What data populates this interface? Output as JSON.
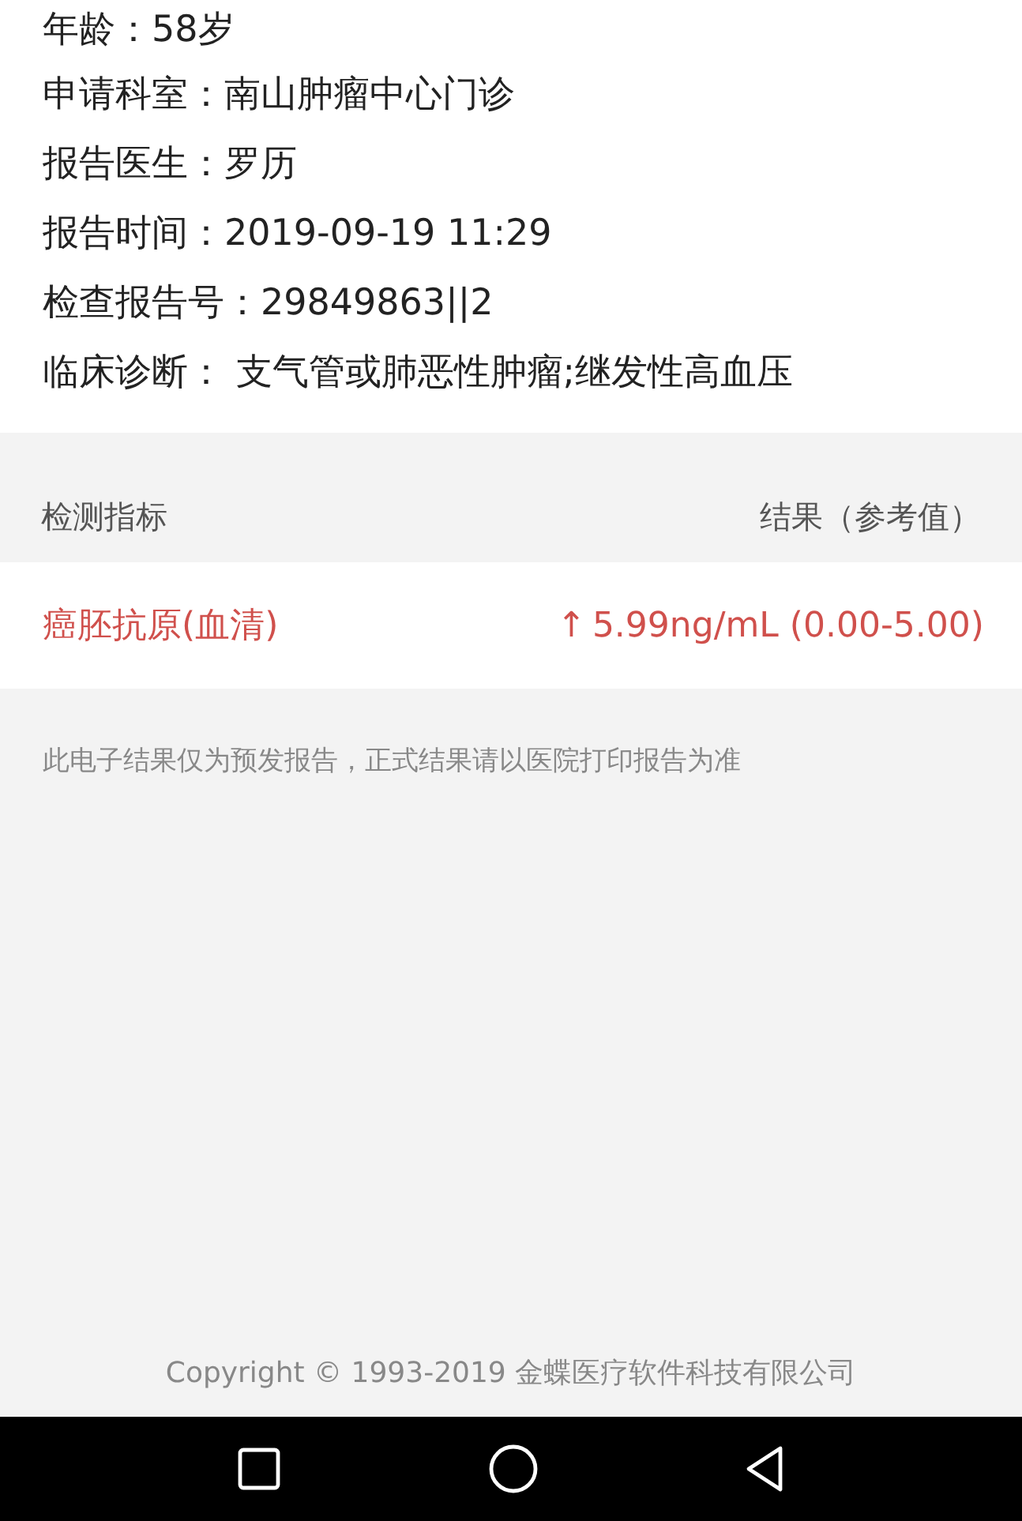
{
  "info_lines": [
    "年龄：58岁",
    "申请科室：南山肿瘤中心门诊",
    "报告医生：罗历",
    "报告时间：2019-09-19 11:29",
    "检查报告号：29849863||2",
    "临床诊断： 支气管或肺恶性肿瘤;继发性高血压"
  ],
  "table": {
    "columns": [
      "检测指标",
      "结果（参考值）"
    ],
    "rows": [
      {
        "name": "癌胚抗原(血清)",
        "abnormal": true,
        "arrow": "↑",
        "result": "5.99ng/mL (0.00-5.00)"
      }
    ]
  },
  "notice": "此电子结果仅为预发报告，正式结果请以医院打印报告为准",
  "copyright": "Copyright © 1993-2019 金蝶医疗软件科技有限公司",
  "nav_bar": {
    "buttons": [
      {
        "kind": "square"
      },
      {
        "kind": "circle"
      },
      {
        "kind": "triangle"
      }
    ]
  }
}
